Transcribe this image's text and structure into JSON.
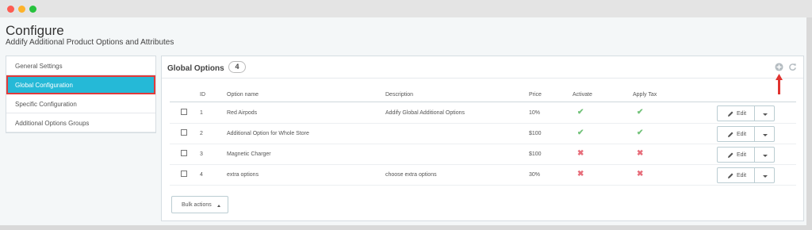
{
  "page": {
    "title": "Configure",
    "subtitle": "Addify Additional Product Options and Attributes"
  },
  "sidebar": {
    "items": [
      {
        "label": "General Settings",
        "active": false
      },
      {
        "label": "Global Configuration",
        "active": true
      },
      {
        "label": "Specific Configuration",
        "active": false
      },
      {
        "label": "Additional Options Groups",
        "active": false
      }
    ]
  },
  "panel": {
    "title": "Global Options",
    "count": "4",
    "add_icon": "plus-circle-icon",
    "refresh_icon": "refresh-icon"
  },
  "table": {
    "columns": [
      "ID",
      "Option name",
      "Description",
      "Price",
      "Activate",
      "Apply Tax"
    ],
    "rows": [
      {
        "id": "1",
        "name": "Red Airpods",
        "description": "Addify Global Additional Options",
        "price": "10%",
        "activate": "check",
        "apply_tax": "check"
      },
      {
        "id": "2",
        "name": "Additional Option for Whole Store",
        "description": "",
        "price": "$100",
        "activate": "check",
        "apply_tax": "check"
      },
      {
        "id": "3",
        "name": "Magnetic Charger",
        "description": "",
        "price": "$100",
        "activate": "cross",
        "apply_tax": "cross"
      },
      {
        "id": "4",
        "name": "extra options",
        "description": "choose extra options",
        "price": "30%",
        "activate": "cross",
        "apply_tax": "cross"
      }
    ],
    "edit_label": "Edit",
    "check_symbol": "✔",
    "cross_symbol": "✖"
  },
  "bulk": {
    "label": "Bulk actions"
  },
  "colors": {
    "accent": "#25b9d7",
    "highlight_border": "#e23a3a",
    "check": "#72c279",
    "cross": "#e76d7a"
  }
}
